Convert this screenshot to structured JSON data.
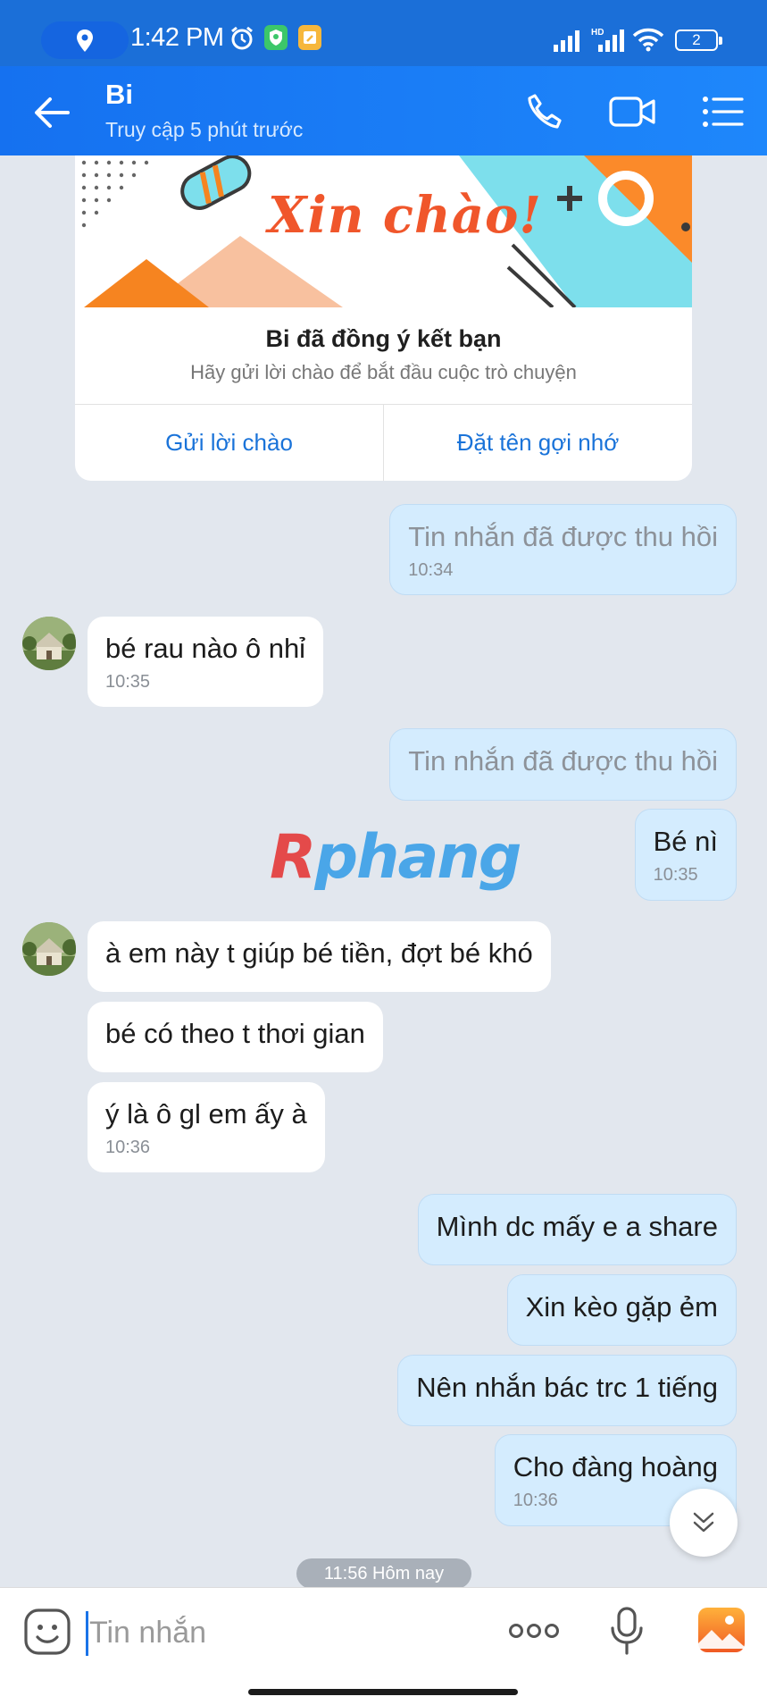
{
  "status_bar": {
    "time": "1:42 PM",
    "battery": "2",
    "icons": [
      "location-icon",
      "alarm-icon",
      "shield-app-icon",
      "notes-app-icon",
      "signal-icon",
      "hd-signal-icon",
      "wifi-icon",
      "battery-icon"
    ]
  },
  "header": {
    "contact_name": "Bi",
    "last_seen": "Truy cập 5 phút trước",
    "icons": [
      "back-arrow-icon",
      "phone-icon",
      "video-call-icon",
      "menu-list-icon"
    ]
  },
  "friend_card": {
    "banner_text": "Xin chào!",
    "title": "Bi đã đồng ý kết bạn",
    "subtitle": "Hãy gửi lời chào để bắt đầu cuộc trò chuyện",
    "action_greet": "Gửi lời chào",
    "action_nickname": "Đặt tên gợi nhớ"
  },
  "messages": [
    {
      "direction": "out",
      "text": "Tin nhắn đã được thu hồi",
      "time": "10:34",
      "recalled": true
    },
    {
      "direction": "in",
      "text": "bé rau nào ô nhỉ",
      "time": "10:35"
    },
    {
      "direction": "out",
      "text": "Tin nhắn đã được thu hồi",
      "time": "",
      "recalled": true
    },
    {
      "direction": "out",
      "text": "Bé nì",
      "time": "10:35"
    },
    {
      "direction": "in",
      "text": "à em này t giúp bé tiền, đợt bé khó",
      "time": ""
    },
    {
      "direction": "in",
      "text": "bé có theo t thơi gian",
      "time": ""
    },
    {
      "direction": "in",
      "text": "ý là ô gl em ấy à",
      "time": "10:36"
    },
    {
      "direction": "out",
      "text": "Mình dc mấy e a share",
      "time": ""
    },
    {
      "direction": "out",
      "text": "Xin kèo gặp ẻm",
      "time": ""
    },
    {
      "direction": "out",
      "text": "Nên nhắn bác trc 1 tiếng",
      "time": ""
    },
    {
      "direction": "out",
      "text": "Cho đàng hoàng",
      "time": "10:36"
    }
  ],
  "watermark": {
    "first": "R",
    "rest": "phang"
  },
  "day_separator": "11:56 Hôm nay",
  "composer": {
    "placeholder": "Tin nhắn",
    "icons": [
      "emoji-icon",
      "more-dots-icon",
      "microphone-icon",
      "image-gallery-icon"
    ]
  },
  "colors": {
    "header": "#1e87fb",
    "outgoing_bubble": "#d4ecfe",
    "incoming_bubble": "#ffffff",
    "background": "#e2e7ee",
    "link": "#1a73d9"
  }
}
